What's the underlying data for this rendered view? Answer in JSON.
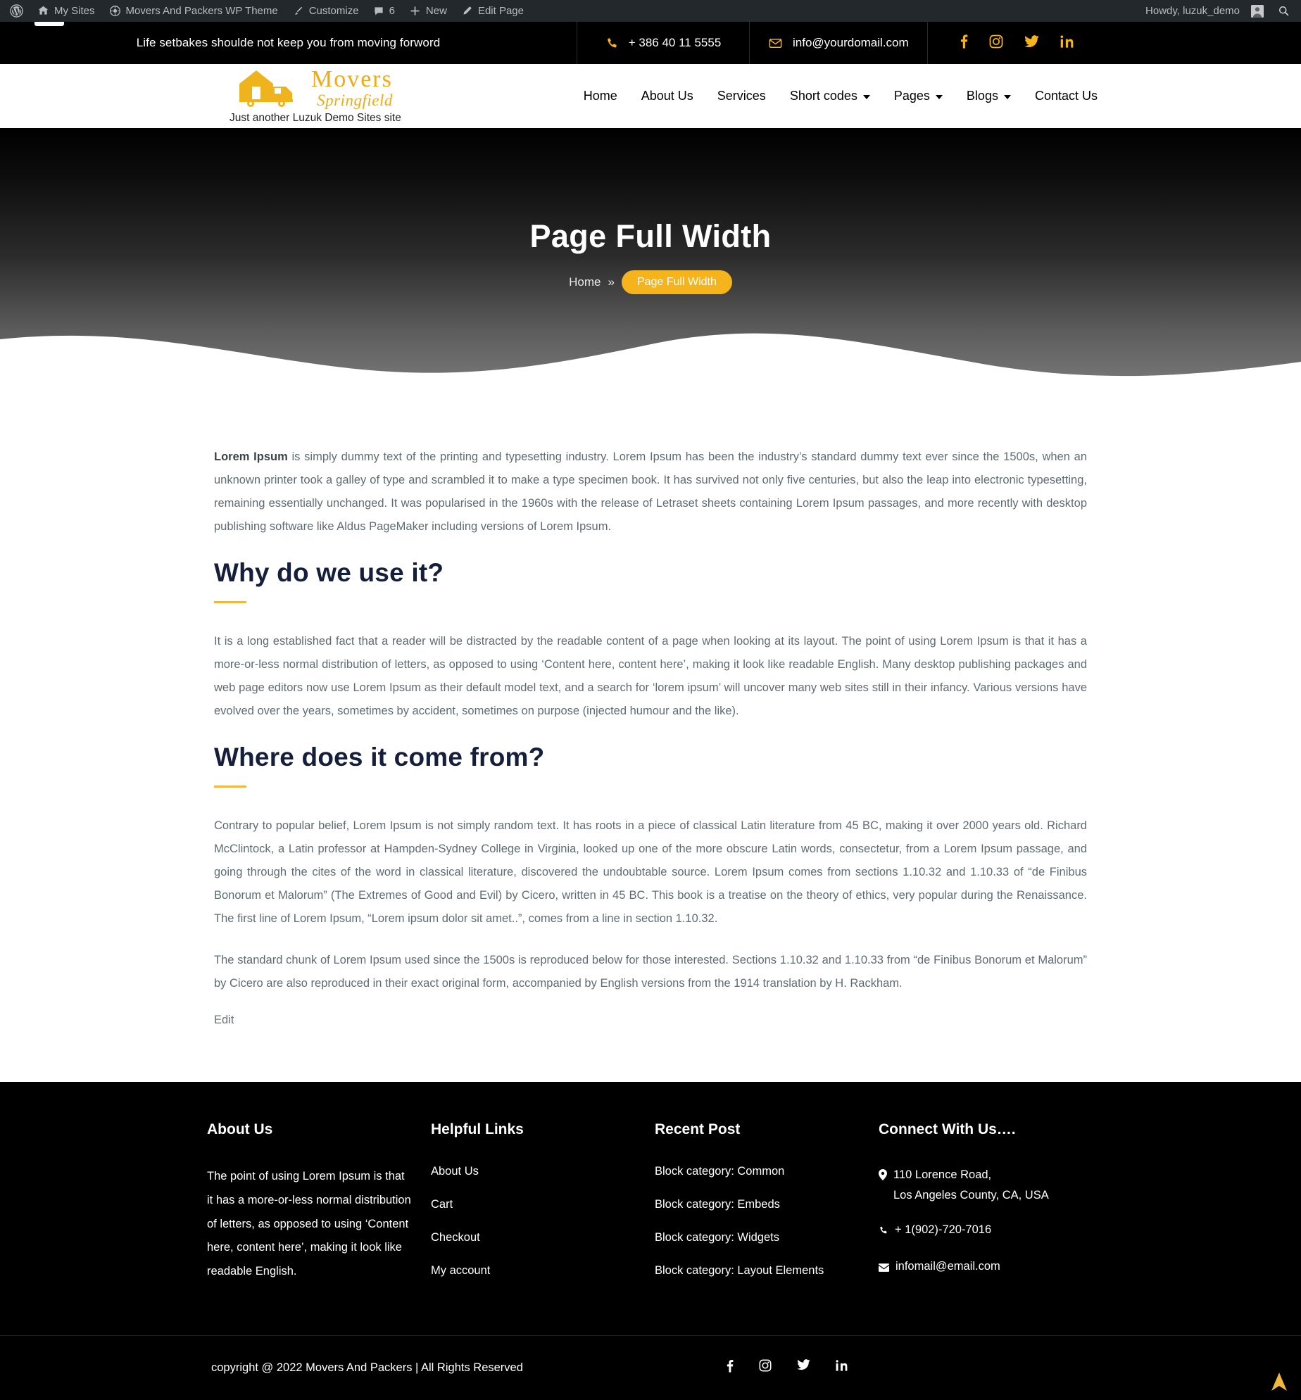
{
  "adminbar": {
    "items": [
      {
        "label": "",
        "icon": "wordpress-icon"
      },
      {
        "label": "My Sites",
        "icon": "sites-icon"
      },
      {
        "label": "Movers And Packers WP Theme",
        "icon": "site-icon"
      },
      {
        "label": "Customize",
        "icon": "brush-icon"
      },
      {
        "label": "6",
        "icon": "comment-icon"
      },
      {
        "label": "New",
        "icon": "plus-icon"
      },
      {
        "label": "Edit Page",
        "icon": "pencil-icon"
      }
    ],
    "howdy": "Howdy, luzuk_demo",
    "search_icon": "search-icon"
  },
  "topbar": {
    "tagline": "Life setbakes shoulde not keep you from moving forword",
    "phone": "+ 386 40 11 5555",
    "email": "info@yourdomail.com",
    "socials": [
      "facebook-icon",
      "instagram-icon",
      "twitter-icon",
      "linkedin-icon"
    ],
    "accent": "#f5b31c"
  },
  "header": {
    "logo_main": "Movers",
    "logo_sub": "Springfield",
    "tagline": "Just another Luzuk Demo Sites site",
    "nav": [
      {
        "label": "Home",
        "has_caret": false
      },
      {
        "label": "About Us",
        "has_caret": false
      },
      {
        "label": "Services",
        "has_caret": false
      },
      {
        "label": "Short codes",
        "has_caret": true
      },
      {
        "label": "Pages",
        "has_caret": true
      },
      {
        "label": "Blogs",
        "has_caret": true
      },
      {
        "label": "Contact Us",
        "has_caret": false
      }
    ]
  },
  "hero": {
    "title": "Page Full Width",
    "breadcrumb_home": "Home",
    "breadcrumb_sep": "»",
    "breadcrumb_current": "Page Full Width"
  },
  "main": {
    "intro_lead": "Lorem Ipsum",
    "intro_rest": " is simply dummy text of the printing and typesetting industry. Lorem Ipsum has been the industry’s standard dummy text ever since the 1500s, when an unknown printer took a galley of type and scrambled it to make a type specimen book. It has survived not only five centuries, but also the leap into electronic typesetting, remaining essentially unchanged. It was popularised in the 1960s with the release of Letraset sheets containing Lorem Ipsum passages, and more recently with desktop publishing software like Aldus PageMaker including versions of Lorem Ipsum.",
    "heading1": "Why do we use it?",
    "para1": "It is a long established fact that a reader will be distracted by the readable content of a page when looking at its layout. The point of using Lorem Ipsum is that it has a more-or-less normal distribution of letters, as opposed to using ‘Content here, content here’, making it look like readable English. Many desktop publishing packages and web page editors now use Lorem Ipsum as their default model text, and a search for ‘lorem ipsum’ will uncover many web sites still in their infancy. Various versions have evolved over the years, sometimes by accident, sometimes on purpose (injected humour and the like).",
    "heading2": "Where does it come from?",
    "para2": "Contrary to popular belief, Lorem Ipsum is not simply random text. It has roots in a piece of classical Latin literature from 45 BC, making it over 2000 years old. Richard McClintock, a Latin professor at Hampden-Sydney College in Virginia, looked up one of the more obscure Latin words, consectetur, from a Lorem Ipsum passage, and going through the cites of the word in classical literature, discovered the undoubtable source. Lorem Ipsum comes from sections 1.10.32 and 1.10.33 of “de Finibus Bonorum et Malorum” (The Extremes of Good and Evil) by Cicero, written in 45 BC. This book is a treatise on the theory of ethics, very popular during the Renaissance. The first line of Lorem Ipsum, “Lorem ipsum dolor sit amet..”, comes from a line in section 1.10.32.",
    "para3": "The standard chunk of Lorem Ipsum used since the 1500s is reproduced below for those interested. Sections 1.10.32 and 1.10.33 from “de Finibus Bonorum et Malorum” by Cicero are also reproduced in their exact original form, accompanied by English versions from the 1914 translation by H. Rackham.",
    "edit_link": "Edit"
  },
  "footer": {
    "about": {
      "title": "About Us",
      "text": "The point of using Lorem Ipsum is that it has a more-or-less normal distribution of letters, as opposed to using ‘Content here, content here’, making it look like readable English."
    },
    "helpful": {
      "title": "Helpful Links",
      "links": [
        "About Us",
        "Cart",
        "Checkout",
        "My account"
      ]
    },
    "recent": {
      "title": "Recent Post",
      "posts": [
        "Block category: Common",
        "Block category: Embeds",
        "Block category: Widgets",
        "Block category: Layout Elements"
      ]
    },
    "connect": {
      "title": "Connect With Us….",
      "address_line1": "110 Lorence Road,",
      "address_line2": "Los Angeles County, CA, USA",
      "phone": "+ 1(902)-720-7016",
      "email": "infomail@email.com"
    },
    "copyright": "copyright @ 2022 Movers And Packers | All Rights Reserved",
    "socials": [
      "facebook-icon",
      "instagram-icon",
      "twitter-icon",
      "linkedin-icon"
    ],
    "scroll_top_icon": "scroll-to-top-icon"
  }
}
